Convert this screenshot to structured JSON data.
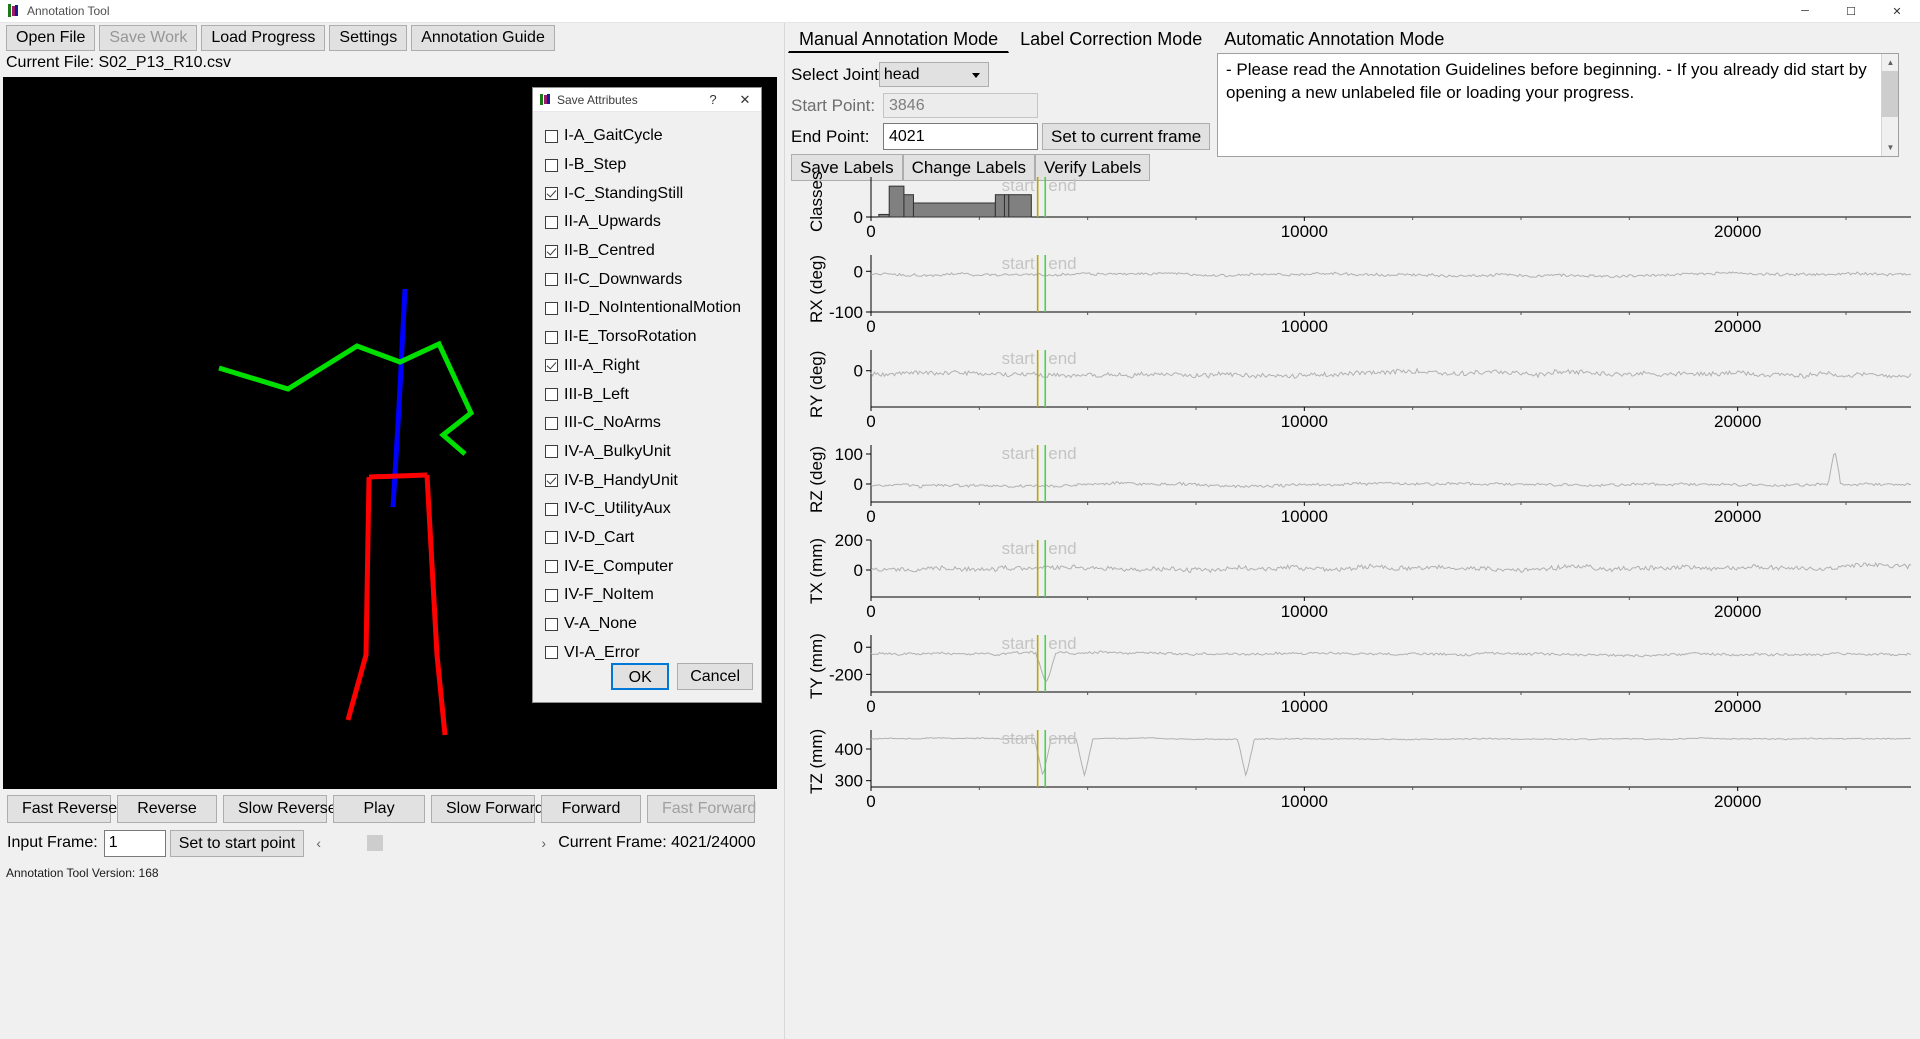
{
  "window": {
    "title": "Annotation Tool",
    "minimize": "─",
    "maximize": "☐",
    "close": "✕"
  },
  "toolbar": {
    "buttons": [
      {
        "label": "Open File",
        "enabled": true
      },
      {
        "label": "Save Work",
        "enabled": false
      },
      {
        "label": "Load Progress",
        "enabled": true
      },
      {
        "label": "Settings",
        "enabled": true
      },
      {
        "label": "Annotation Guide",
        "enabled": true
      }
    ],
    "current_file": "Current File: S02_P13_R10.csv"
  },
  "playback": {
    "buttons": [
      {
        "label": "Fast Reverse",
        "enabled": true
      },
      {
        "label": "Reverse",
        "enabled": true
      },
      {
        "label": "Slow Reverse",
        "enabled": true
      },
      {
        "label": "Play",
        "enabled": true
      },
      {
        "label": "Slow Forward",
        "enabled": true
      },
      {
        "label": "Forward",
        "enabled": true
      },
      {
        "label": "Fast Forward",
        "enabled": false
      }
    ],
    "input_frame_label": "Input Frame:",
    "input_frame_value": "1",
    "set_start_button": "Set to start point",
    "scroll_left": "‹",
    "scroll_right": "›",
    "current_frame": "Current Frame: 4021/24000"
  },
  "status": {
    "version": "Annotation Tool Version: 168"
  },
  "dialog": {
    "title": "Save Attributes",
    "help_glyph": "?",
    "close_glyph": "✕",
    "attributes": [
      {
        "label": "I-A_GaitCycle",
        "checked": false
      },
      {
        "label": "I-B_Step",
        "checked": false
      },
      {
        "label": "I-C_StandingStill",
        "checked": true
      },
      {
        "label": "II-A_Upwards",
        "checked": false
      },
      {
        "label": "II-B_Centred",
        "checked": true
      },
      {
        "label": "II-C_Downwards",
        "checked": false
      },
      {
        "label": "II-D_NoIntentionalMotion",
        "checked": false
      },
      {
        "label": "II-E_TorsoRotation",
        "checked": false
      },
      {
        "label": "III-A_Right",
        "checked": true
      },
      {
        "label": "III-B_Left",
        "checked": false
      },
      {
        "label": "III-C_NoArms",
        "checked": false
      },
      {
        "label": "IV-A_BulkyUnit",
        "checked": false
      },
      {
        "label": "IV-B_HandyUnit",
        "checked": true
      },
      {
        "label": "IV-C_UtilityAux",
        "checked": false
      },
      {
        "label": "IV-D_Cart",
        "checked": false
      },
      {
        "label": "IV-E_Computer",
        "checked": false
      },
      {
        "label": "IV-F_NoItem",
        "checked": false
      },
      {
        "label": "V-A_None",
        "checked": false
      },
      {
        "label": "VI-A_Error",
        "checked": false
      }
    ],
    "ok_label": "OK",
    "cancel_label": "Cancel"
  },
  "right": {
    "tabs": [
      {
        "label": "Manual Annotation Mode",
        "active": true
      },
      {
        "label": "Label Correction Mode",
        "active": false
      },
      {
        "label": "Automatic Annotation Mode",
        "active": false
      }
    ],
    "select_joint_label": "Select Joint",
    "selected_joint": "head",
    "start_point_label": "Start Point:",
    "start_point_value": "3846",
    "end_point_label": "End Point:",
    "end_point_value": "4021",
    "set_current_frame_button": "Set to current frame",
    "label_buttons": [
      "Save Labels",
      "Change Labels",
      "Verify Labels"
    ],
    "guidelines_text": "- Please read the Annotation Guidelines before beginning.\n- If you already did start by opening a new unlabeled file or loading your progress.",
    "scroll_up_glyph": "▲",
    "scroll_down_glyph": "▼"
  },
  "chart_data": [
    {
      "type": "bar",
      "name": "classes",
      "ylabel": "Classes",
      "xlabel": "",
      "xlim": [
        0,
        24000
      ],
      "ylim": [
        0,
        7
      ],
      "xticks": [
        0,
        10000,
        20000
      ],
      "xticklabels": [
        "0",
        "10000",
        "20000"
      ],
      "yticks": [
        0
      ],
      "yticklabels": [
        "0"
      ],
      "marker_start": {
        "value": 3846,
        "label": "start",
        "color": "#b8a700"
      },
      "marker_end": {
        "value": 4021,
        "label": "end",
        "color": "#4ad24a"
      },
      "segments": [
        {
          "x0": 180,
          "x1": 420,
          "height": 0.45
        },
        {
          "x0": 420,
          "x1": 760,
          "height": 5.4
        },
        {
          "x0": 760,
          "x1": 980,
          "height": 3.9
        },
        {
          "x0": 980,
          "x1": 2870,
          "height": 2.45
        },
        {
          "x0": 2870,
          "x1": 3080,
          "height": 3.9
        },
        {
          "x0": 3080,
          "x1": 3180,
          "height": 3.9
        },
        {
          "x0": 3180,
          "x1": 3700,
          "height": 3.9
        }
      ]
    },
    {
      "type": "line",
      "name": "rx",
      "ylabel": "RX (deg)",
      "xlim": [
        0,
        24000
      ],
      "ylim": [
        -100,
        40
      ],
      "xticks": [
        0,
        10000,
        20000
      ],
      "xticklabels": [
        "0",
        "10000",
        "20000"
      ],
      "yticks": [
        0,
        -100
      ],
      "yticklabels": [
        "0",
        "-100"
      ],
      "marker_start": {
        "value": 3846,
        "label": "start",
        "color": "#b8a700"
      },
      "marker_end": {
        "value": 4021,
        "label": "end",
        "color": "#4ad24a"
      },
      "baseline": -8,
      "noise": 11,
      "seed": 11
    },
    {
      "type": "line",
      "name": "ry",
      "ylabel": "RY (deg)",
      "xlim": [
        0,
        24000
      ],
      "ylim": [
        -70,
        40
      ],
      "xticks": [
        0,
        10000,
        20000
      ],
      "xticklabels": [
        "0",
        "10000",
        "20000"
      ],
      "yticks": [
        0
      ],
      "yticklabels": [
        "0"
      ],
      "marker_start": {
        "value": 3846,
        "label": "start",
        "color": "#b8a700"
      },
      "marker_end": {
        "value": 4021,
        "label": "end",
        "color": "#4ad24a"
      },
      "baseline": -6,
      "noise": 15,
      "seed": 23
    },
    {
      "type": "line",
      "name": "rz",
      "ylabel": "RZ (deg)",
      "xlim": [
        0,
        24000
      ],
      "ylim": [
        -60,
        130
      ],
      "xticks": [
        0,
        10000,
        20000
      ],
      "xticklabels": [
        "0",
        "10000",
        "20000"
      ],
      "yticks": [
        100,
        0
      ],
      "yticklabels": [
        "100",
        "0"
      ],
      "marker_start": {
        "value": 3846,
        "label": "start",
        "color": "#b8a700"
      },
      "marker_end": {
        "value": 4021,
        "label": "end",
        "color": "#4ad24a"
      },
      "baseline": -5,
      "noise": 16,
      "seed": 37
    },
    {
      "type": "line",
      "name": "tx",
      "ylabel": "TX (mm)",
      "xlim": [
        0,
        24000
      ],
      "ylim": [
        -180,
        200
      ],
      "xticks": [
        0,
        10000,
        20000
      ],
      "xticklabels": [
        "0",
        "10000",
        "20000"
      ],
      "yticks": [
        200,
        0
      ],
      "yticklabels": [
        "200",
        "0"
      ],
      "marker_start": {
        "value": 3846,
        "label": "start",
        "color": "#b8a700"
      },
      "marker_end": {
        "value": 4021,
        "label": "end",
        "color": "#4ad24a"
      },
      "baseline": 10,
      "noise": 50,
      "seed": 53
    },
    {
      "type": "line",
      "name": "ty",
      "ylabel": "TY (mm)",
      "xlim": [
        0,
        24000
      ],
      "ylim": [
        -330,
        90
      ],
      "xticks": [
        0,
        10000,
        20000
      ],
      "xticklabels": [
        "0",
        "10000",
        "20000"
      ],
      "yticks": [
        0,
        -200
      ],
      "yticklabels": [
        "0",
        "-200"
      ],
      "marker_start": {
        "value": 3846,
        "label": "start",
        "color": "#b8a700"
      },
      "marker_end": {
        "value": 4021,
        "label": "end",
        "color": "#4ad24a"
      },
      "baseline": -48,
      "noise": 30,
      "seed": 71
    },
    {
      "type": "line",
      "name": "tz",
      "ylabel": "TZ (mm)",
      "xlim": [
        0,
        24000
      ],
      "ylim": [
        280,
        460
      ],
      "xticks": [
        0,
        10000,
        20000
      ],
      "xticklabels": [
        "0",
        "10000",
        "20000"
      ],
      "yticks": [
        400,
        300
      ],
      "yticklabels": [
        "400",
        "300"
      ],
      "marker_start": {
        "value": 3846,
        "label": "start",
        "color": "#b8a700"
      },
      "marker_end": {
        "value": 4021,
        "label": "end",
        "color": "#4ad24a"
      },
      "baseline": 432,
      "noise": 6,
      "seed": 97
    }
  ],
  "skeleton": {
    "colors": {
      "torso": "#0000ff",
      "arms": "#00e000",
      "legs": "#ff0000"
    }
  }
}
